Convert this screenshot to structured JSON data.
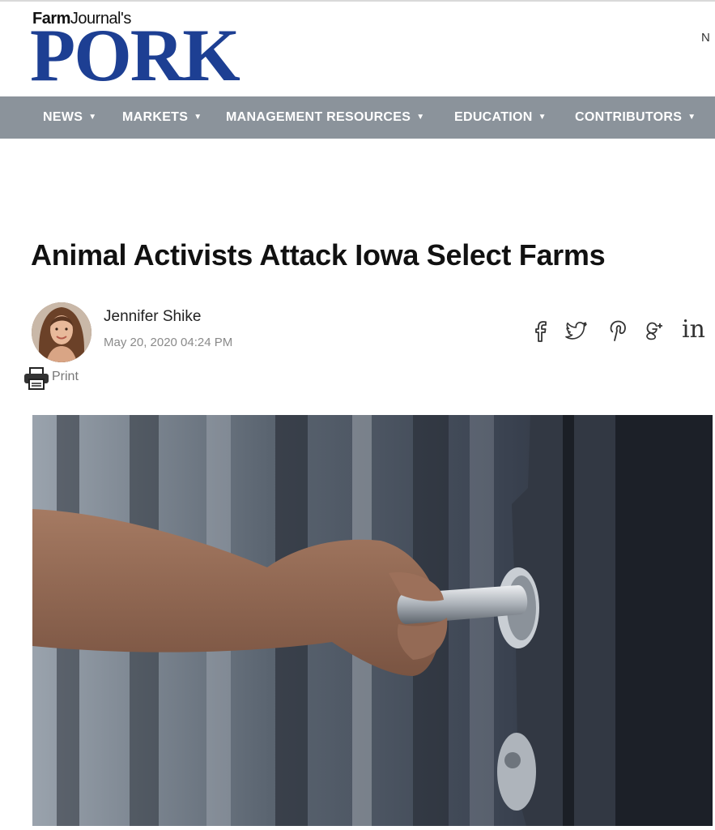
{
  "header": {
    "brand_small_bold": "Farm",
    "brand_small_regular": "Journal's",
    "brand_big": "PORK",
    "right_text": "N"
  },
  "nav": {
    "items": [
      {
        "label": "NEWS"
      },
      {
        "label": "MARKETS"
      },
      {
        "label": "MANAGEMENT RESOURCES"
      },
      {
        "label": "EDUCATION"
      },
      {
        "label": "CONTRIBUTORS"
      }
    ]
  },
  "article": {
    "title": "Animal Activists Attack Iowa Select Farms",
    "author": "Jennifer Shike",
    "date": "May 20, 2020 04:24 PM",
    "print_label": "Print"
  },
  "share": {
    "icons": [
      "facebook-icon",
      "twitter-icon",
      "pinterest-icon",
      "google-plus-icon",
      "linkedin-icon"
    ],
    "linkedin_text": "in"
  },
  "colors": {
    "brand_blue": "#1d3f93",
    "nav_bg": "#8b939b",
    "date_gray": "#8a8a8a"
  }
}
